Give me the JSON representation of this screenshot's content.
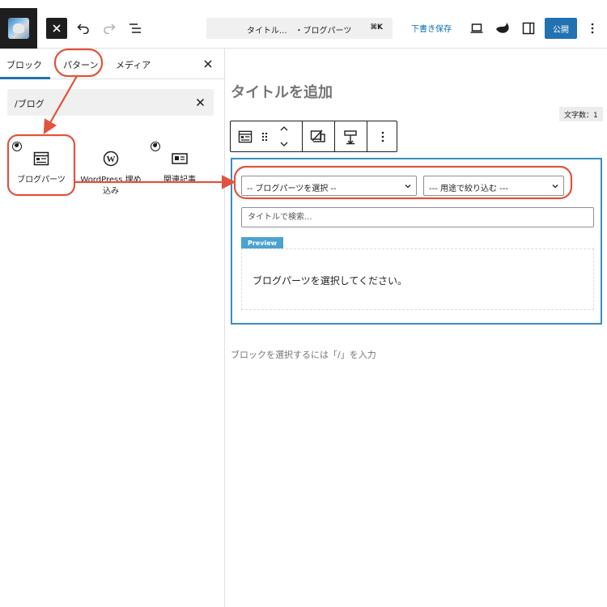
{
  "toolbar": {
    "close_icon": "close-icon",
    "undo_icon": "undo-icon",
    "redo_icon": "redo-icon",
    "outline_icon": "list-view-icon",
    "command_title": "タイトル...　・ブログパーツ",
    "command_shortcut": "⌘K",
    "save_draft": "下書き保存",
    "preview_icon": "laptop-icon",
    "plugin_icon": "plugin-icon",
    "settings_icon": "sidebar-icon",
    "publish": "公開",
    "more_icon": "more-vertical-icon"
  },
  "inserter": {
    "tabs": [
      {
        "label": "ブロック"
      },
      {
        "label": "パターン"
      },
      {
        "label": "メディア"
      }
    ],
    "search_value": "/ブログ",
    "results": [
      {
        "label": "ブログパーツ",
        "icon": "blog-parts-icon"
      },
      {
        "label": "WordPress 埋め込み",
        "icon": "wordpress-icon"
      },
      {
        "label": "関連記事",
        "icon": "related-posts-icon"
      }
    ]
  },
  "editor": {
    "post_title_placeholder": "タイトルを追加",
    "word_count": "文字数：1",
    "block": {
      "select_parts": "-- ブログパーツを選択 --",
      "select_filter": "--- 用途で絞り込む ---",
      "title_search_placeholder": "タイトルで検索...",
      "preview_tag": "Preview",
      "preview_message": "ブログパーツを選択してください。"
    },
    "appender": "ブロックを選択するには「/」を入力"
  },
  "colors": {
    "accent": "#2271b1",
    "block_border": "#3a8dbf",
    "annotation": "#e0533d"
  }
}
